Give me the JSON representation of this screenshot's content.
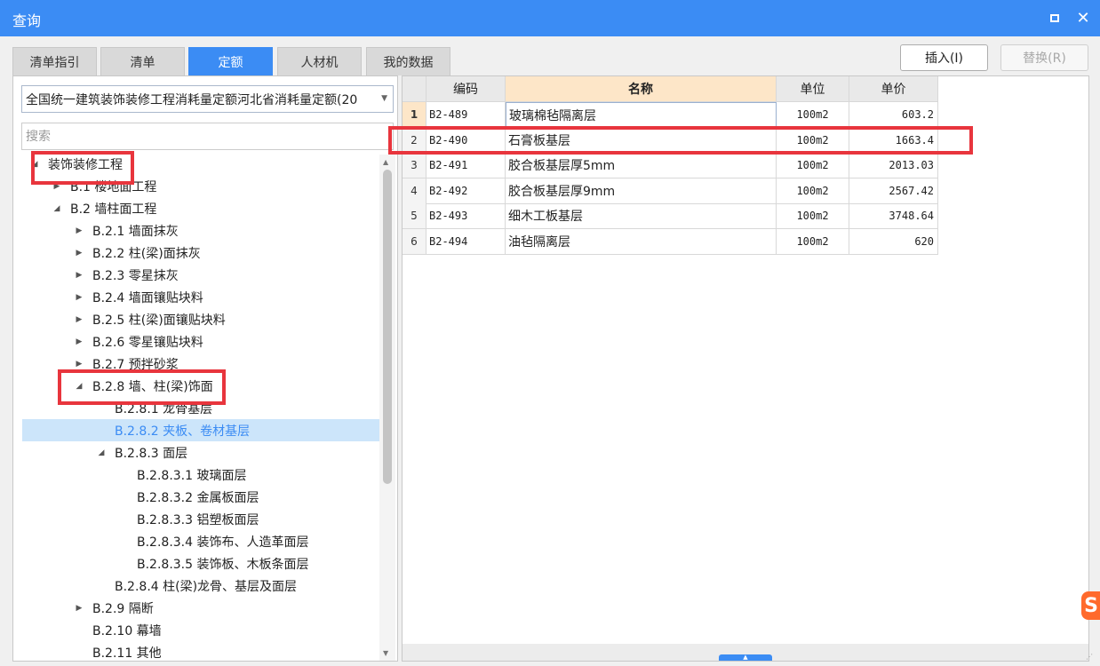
{
  "window": {
    "title": "查询"
  },
  "tabs": [
    "清单指引",
    "清单",
    "定额",
    "人材机",
    "我的数据"
  ],
  "active_tab_index": 2,
  "toolbar": {
    "insert_label": "插入(I)",
    "replace_label": "替换(R)"
  },
  "library_select": {
    "value": "全国统一建筑装饰装修工程消耗量定额河北省消耗量定额(20"
  },
  "search": {
    "placeholder": "搜索"
  },
  "tree": [
    {
      "label": "装饰装修工程",
      "level": 0,
      "state": "expanded"
    },
    {
      "label": "B.1 楼地面工程",
      "level": 1,
      "state": "collapsed"
    },
    {
      "label": "B.2 墙柱面工程",
      "level": 1,
      "state": "expanded"
    },
    {
      "label": "B.2.1 墙面抹灰",
      "level": 2,
      "state": "collapsed"
    },
    {
      "label": "B.2.2 柱(梁)面抹灰",
      "level": 2,
      "state": "collapsed"
    },
    {
      "label": "B.2.3 零星抹灰",
      "level": 2,
      "state": "collapsed"
    },
    {
      "label": "B.2.4 墙面镶贴块料",
      "level": 2,
      "state": "collapsed"
    },
    {
      "label": "B.2.5 柱(梁)面镶贴块料",
      "level": 2,
      "state": "collapsed"
    },
    {
      "label": "B.2.6 零星镶贴块料",
      "level": 2,
      "state": "collapsed"
    },
    {
      "label": "B.2.7 预拌砂浆",
      "level": 2,
      "state": "collapsed"
    },
    {
      "label": "B.2.8 墙、柱(梁)饰面",
      "level": 2,
      "state": "expanded"
    },
    {
      "label": "B.2.8.1 龙骨基层",
      "level": 3,
      "state": "leaf"
    },
    {
      "label": "B.2.8.2 夹板、卷材基层",
      "level": 3,
      "state": "leaf",
      "selected": true
    },
    {
      "label": "B.2.8.3 面层",
      "level": 3,
      "state": "expanded"
    },
    {
      "label": "B.2.8.3.1 玻璃面层",
      "level": 4,
      "state": "leaf"
    },
    {
      "label": "B.2.8.3.2 金属板面层",
      "level": 4,
      "state": "leaf"
    },
    {
      "label": "B.2.8.3.3 铝塑板面层",
      "level": 4,
      "state": "leaf"
    },
    {
      "label": "B.2.8.3.4 装饰布、人造革面层",
      "level": 4,
      "state": "leaf"
    },
    {
      "label": "B.2.8.3.5 装饰板、木板条面层",
      "level": 4,
      "state": "leaf"
    },
    {
      "label": "B.2.8.4 柱(梁)龙骨、基层及面层",
      "level": 3,
      "state": "leaf"
    },
    {
      "label": "B.2.9 隔断",
      "level": 2,
      "state": "collapsed"
    },
    {
      "label": "B.2.10 幕墙",
      "level": 2,
      "state": "leaf"
    },
    {
      "label": "B.2.11 其他",
      "level": 2,
      "state": "leaf"
    }
  ],
  "table": {
    "headers": [
      "编码",
      "名称",
      "单位",
      "单价"
    ],
    "rows": [
      {
        "num": "1",
        "code": "B2-489",
        "name": "玻璃棉毡隔离层",
        "unit": "100m2",
        "price": "603.2"
      },
      {
        "num": "2",
        "code": "B2-490",
        "name": "石膏板基层",
        "unit": "100m2",
        "price": "1663.4"
      },
      {
        "num": "3",
        "code": "B2-491",
        "name": "胶合板基层厚5mm",
        "unit": "100m2",
        "price": "2013.03"
      },
      {
        "num": "4",
        "code": "B2-492",
        "name": "胶合板基层厚9mm",
        "unit": "100m2",
        "price": "2567.42"
      },
      {
        "num": "5",
        "code": "B2-493",
        "name": "细木工板基层",
        "unit": "100m2",
        "price": "3748.64"
      },
      {
        "num": "6",
        "code": "B2-494",
        "name": "油毡隔离层",
        "unit": "100m2",
        "price": "620"
      }
    ]
  },
  "colors": {
    "accent": "#3b8cf4",
    "highlight": "#e8353d",
    "selection": "#cce5fa",
    "header_highlight": "#fde6c8"
  }
}
